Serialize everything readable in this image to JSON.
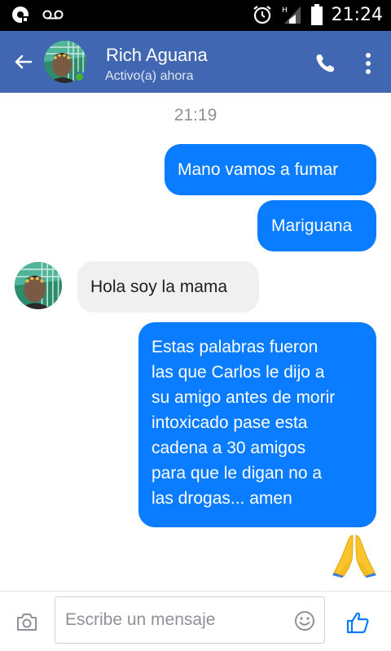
{
  "status_bar": {
    "time": "21:24",
    "icons": [
      "notification-icon",
      "voicemail-icon",
      "alarm-icon",
      "signal-icon",
      "battery-icon"
    ]
  },
  "header": {
    "contact_name": "Rich Aguana",
    "status": "Activo(a) ahora",
    "icons": [
      "back-arrow-icon",
      "phone-icon",
      "more-options-icon"
    ],
    "accent": "#4267b2"
  },
  "chat": {
    "timestamp": "21:19",
    "messages": [
      {
        "direction": "outgoing",
        "text": "Mano vamos a fumar"
      },
      {
        "direction": "outgoing",
        "text": "Mariguana"
      },
      {
        "direction": "incoming",
        "text": "Hola soy la mama"
      },
      {
        "direction": "outgoing",
        "lines": [
          "Estas palabras fueron",
          "las que Carlos le dijo a",
          "su amigo antes de morir",
          "intoxicado pase esta",
          "cadena a 30 amigos",
          "para que le digan no a",
          "las drogas... amen"
        ]
      },
      {
        "direction": "outgoing",
        "emoji": "praying-hands"
      }
    ],
    "outgoing_color": "#0a7cff",
    "incoming_color": "#f1f0f0"
  },
  "composer": {
    "placeholder": "Escribe un mensaje",
    "icons": [
      "camera-icon",
      "emoji-icon",
      "thumbs-up-icon"
    ]
  }
}
